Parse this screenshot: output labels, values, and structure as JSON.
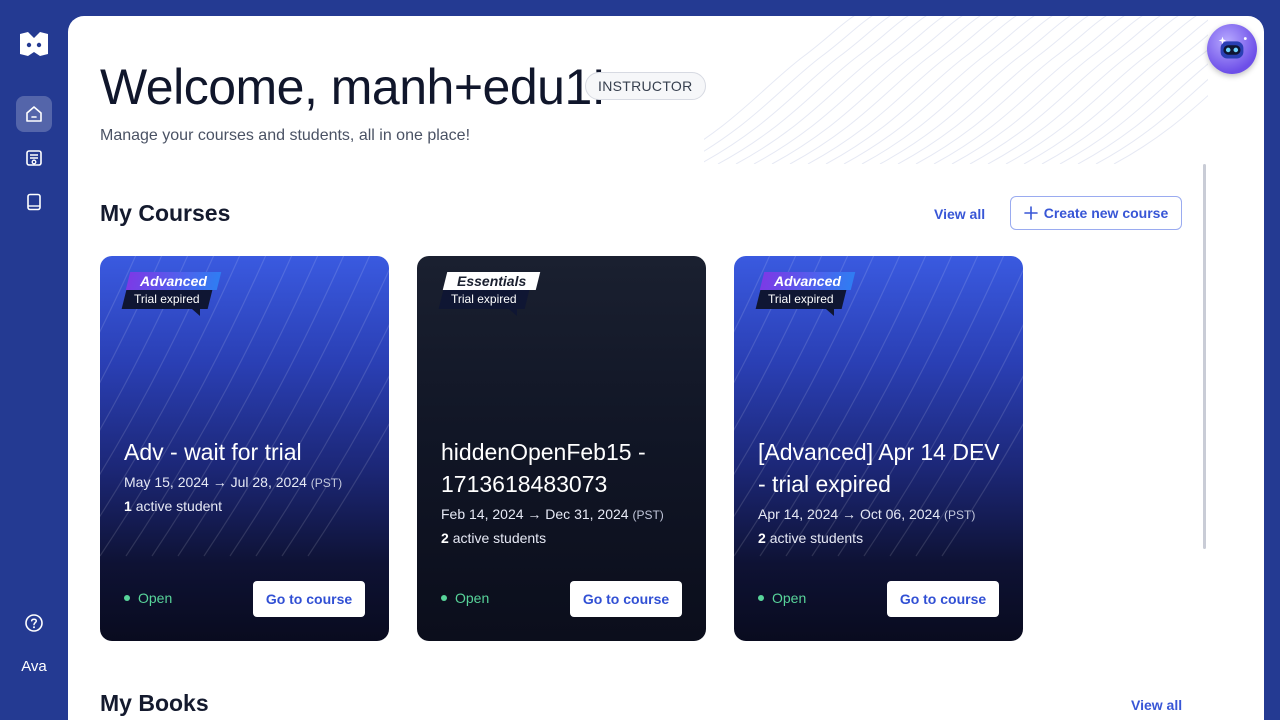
{
  "sidebar": {
    "items": [
      {
        "icon": "home-icon",
        "active": true
      },
      {
        "icon": "courses-icon",
        "active": false
      },
      {
        "icon": "book-icon",
        "active": false
      }
    ],
    "help_icon": "help-icon",
    "user_label": "Ava"
  },
  "header": {
    "welcome": "Welcome, manh+edu1!",
    "role": "INSTRUCTOR",
    "subtitle": "Manage your courses and students, all in one place!"
  },
  "courses_section": {
    "title": "My Courses",
    "view_all": "View all",
    "create_label": "Create new course"
  },
  "courses": [
    {
      "plan": "Advanced",
      "trial": "Trial expired",
      "title": "Adv - wait for trial",
      "dates": "May 15, 2024 → Jul 28, 2024",
      "tz": "(PST)",
      "count": "1",
      "students_label": "active student",
      "status": "Open",
      "cta": "Go to course"
    },
    {
      "plan": "Essentials",
      "trial": "Trial expired",
      "title": "hiddenOpenFeb15 - 1713618483073",
      "dates": "Feb 14, 2024 → Dec 31, 2024",
      "tz": "(PST)",
      "count": "2",
      "students_label": "active students",
      "status": "Open",
      "cta": "Go to course"
    },
    {
      "plan": "Advanced",
      "trial": "Trial expired",
      "title": "[Advanced] Apr 14 DEV - trial expired",
      "dates": "Apr 14, 2024 → Oct 06, 2024",
      "tz": "(PST)",
      "count": "2",
      "students_label": "active students",
      "status": "Open",
      "cta": "Go to course"
    }
  ],
  "books_section": {
    "title": "My Books",
    "view_all": "View all"
  },
  "colors": {
    "sidebar_bg": "#243a92",
    "accent": "#3856d6",
    "open_status": "#58d49a"
  }
}
